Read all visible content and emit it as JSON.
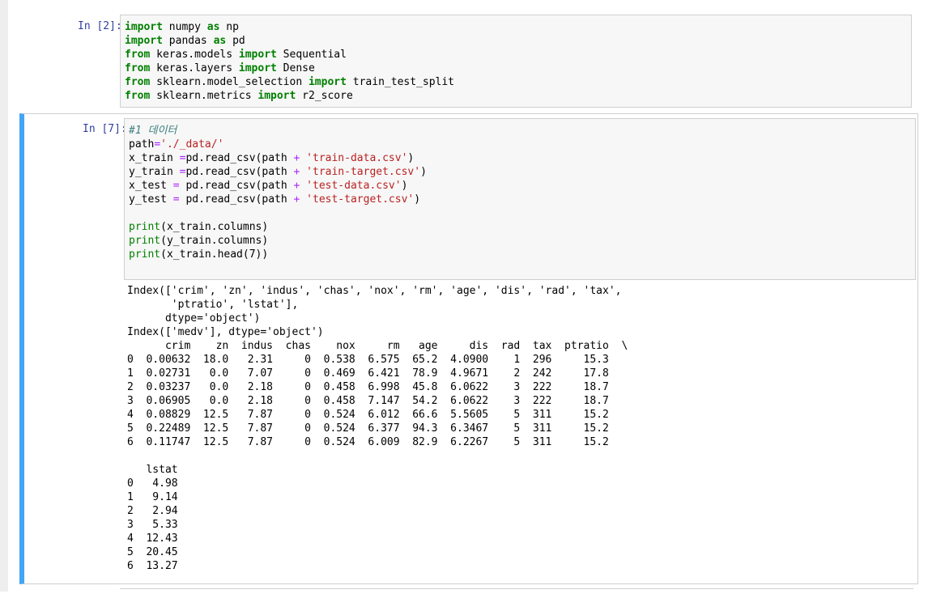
{
  "cells": [
    {
      "prompt": "In [2]:",
      "lines": [
        [
          [
            "kw",
            "import"
          ],
          [
            "t",
            " numpy "
          ],
          [
            "kw",
            "as"
          ],
          [
            "t",
            " np"
          ]
        ],
        [
          [
            "kw",
            "import"
          ],
          [
            "t",
            " pandas "
          ],
          [
            "kw",
            "as"
          ],
          [
            "t",
            " pd"
          ]
        ],
        [
          [
            "kw",
            "from"
          ],
          [
            "t",
            " keras.models "
          ],
          [
            "kw",
            "import"
          ],
          [
            "t",
            " Sequential"
          ]
        ],
        [
          [
            "kw",
            "from"
          ],
          [
            "t",
            " keras.layers "
          ],
          [
            "kw",
            "import"
          ],
          [
            "t",
            " Dense"
          ]
        ],
        [
          [
            "kw",
            "from"
          ],
          [
            "t",
            " sklearn.model_selection "
          ],
          [
            "kw",
            "import"
          ],
          [
            "t",
            " train_test_split"
          ]
        ],
        [
          [
            "kw",
            "from"
          ],
          [
            "t",
            " sklearn.metrics "
          ],
          [
            "kw",
            "import"
          ],
          [
            "t",
            " r2_score"
          ]
        ]
      ]
    },
    {
      "prompt": "In [7]:",
      "lines": [
        [
          [
            "cm",
            "#1 데이터"
          ]
        ],
        [
          [
            "t",
            "path"
          ],
          [
            "op",
            "="
          ],
          [
            "str",
            "'./_data/'"
          ]
        ],
        [
          [
            "t",
            "x_train "
          ],
          [
            "op",
            "="
          ],
          [
            "t",
            "pd.read_csv(path "
          ],
          [
            "op",
            "+"
          ],
          [
            "t",
            " "
          ],
          [
            "str",
            "'train-data.csv'"
          ],
          [
            "t",
            ")"
          ]
        ],
        [
          [
            "t",
            "y_train "
          ],
          [
            "op",
            "="
          ],
          [
            "t",
            "pd.read_csv(path "
          ],
          [
            "op",
            "+"
          ],
          [
            "t",
            " "
          ],
          [
            "str",
            "'train-target.csv'"
          ],
          [
            "t",
            ")"
          ]
        ],
        [
          [
            "t",
            "x_test "
          ],
          [
            "op",
            "="
          ],
          [
            "t",
            " pd.read_csv(path "
          ],
          [
            "op",
            "+"
          ],
          [
            "t",
            " "
          ],
          [
            "str",
            "'test-data.csv'"
          ],
          [
            "t",
            ")"
          ]
        ],
        [
          [
            "t",
            "y_test "
          ],
          [
            "op",
            "="
          ],
          [
            "t",
            " pd.read_csv(path "
          ],
          [
            "op",
            "+"
          ],
          [
            "t",
            " "
          ],
          [
            "str",
            "'test-target.csv'"
          ],
          [
            "t",
            ")"
          ]
        ],
        [
          [
            "t",
            ""
          ]
        ],
        [
          [
            "bi",
            "print"
          ],
          [
            "t",
            "(x_train.columns)"
          ]
        ],
        [
          [
            "bi",
            "print"
          ],
          [
            "t",
            "(y_train.columns)"
          ]
        ],
        [
          [
            "bi",
            "print"
          ],
          [
            "t",
            "(x_train.head(7))"
          ]
        ]
      ],
      "output": [
        "Index(['crim', 'zn', 'indus', 'chas', 'nox', 'rm', 'age', 'dis', 'rad', 'tax',",
        "       'ptratio', 'lstat'],",
        "      dtype='object')",
        "Index(['medv'], dtype='object')",
        "      crim    zn  indus  chas    nox     rm   age     dis  rad  tax  ptratio  \\",
        "0  0.00632  18.0   2.31     0  0.538  6.575  65.2  4.0900    1  296     15.3",
        "1  0.02731   0.0   7.07     0  0.469  6.421  78.9  4.9671    2  242     17.8",
        "2  0.03237   0.0   2.18     0  0.458  6.998  45.8  6.0622    3  222     18.7",
        "3  0.06905   0.0   2.18     0  0.458  7.147  54.2  6.0622    3  222     18.7",
        "4  0.08829  12.5   7.87     0  0.524  6.012  66.6  5.5605    5  311     15.2",
        "5  0.22489  12.5   7.87     0  0.524  6.377  94.3  6.3467    5  311     15.2",
        "6  0.11747  12.5   7.87     0  0.524  6.009  82.9  6.2267    5  311     15.2",
        "",
        "   lstat",
        "0   4.98",
        "1   9.14",
        "2   2.94",
        "3   5.33",
        "4  12.43",
        "5  20.45",
        "6  13.27"
      ]
    }
  ]
}
